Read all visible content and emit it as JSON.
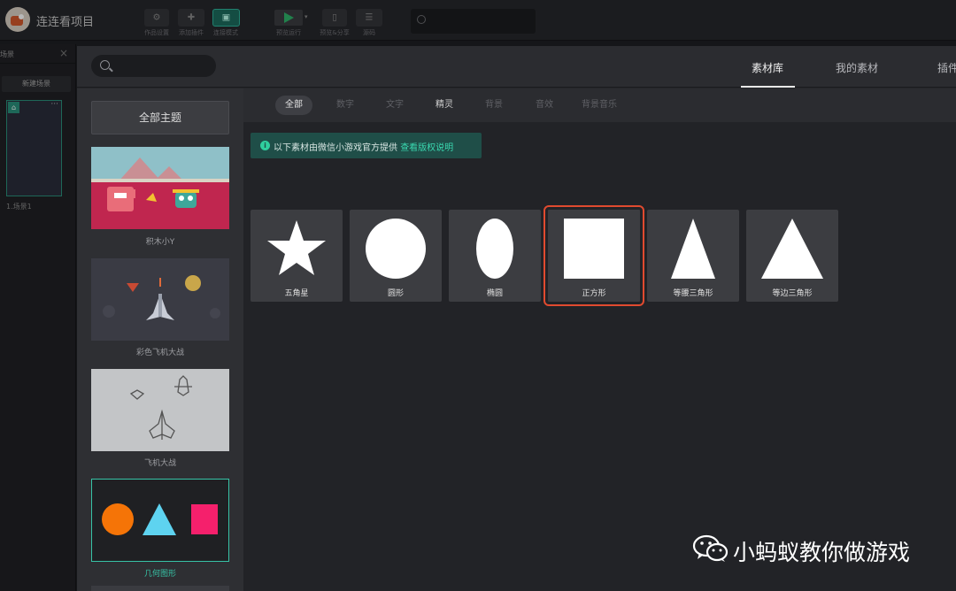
{
  "app": {
    "project_title": "连连看项目",
    "toolbar": [
      {
        "label": "作品设置",
        "icon": "gear-icon"
      },
      {
        "label": "添加插件",
        "icon": "puzzle-icon"
      },
      {
        "label": "连接模式",
        "icon": "device-icon"
      },
      {
        "label": "预览运行",
        "icon": "play-icon"
      },
      {
        "label": "预览&分享",
        "icon": "phone-icon"
      },
      {
        "label": "源码",
        "icon": "list-icon"
      }
    ]
  },
  "scene_panel": {
    "title": "场景",
    "new_scene": "新建场景",
    "scenes": [
      {
        "name": "1.场景1"
      }
    ]
  },
  "modal": {
    "search_placeholder": "",
    "tabs": [
      "素材库",
      "我的素材",
      "插件"
    ],
    "active_tab": "素材库",
    "all_themes": "全部主题",
    "themes": [
      {
        "name": "积木小Y"
      },
      {
        "name": "彩色飞机大战"
      },
      {
        "name": "飞机大战"
      },
      {
        "name": "几何图形",
        "selected": true
      }
    ],
    "filters": [
      "全部",
      "数字",
      "文字",
      "精灵",
      "背景",
      "音效",
      "背景音乐"
    ],
    "active_filter": "全部",
    "notice": {
      "text": "以下素材由微信小游戏官方提供",
      "link": "查看版权说明"
    },
    "assets": [
      {
        "name": "五角星",
        "shape": "star"
      },
      {
        "name": "圆形",
        "shape": "circle"
      },
      {
        "name": "椭圆",
        "shape": "ellipse"
      },
      {
        "name": "正方形",
        "shape": "square",
        "highlighted": true
      },
      {
        "name": "等腰三角形",
        "shape": "isosceles-triangle"
      },
      {
        "name": "等边三角形",
        "shape": "equilateral-triangle"
      }
    ]
  },
  "colors": {
    "accent": "#2fb39a",
    "highlight": "#e04a2f",
    "circle": "#f57407",
    "triangle": "#5ed3f0",
    "square": "#f5206c"
  },
  "watermark": {
    "text": "小蚂蚁教你做游戏",
    "icon": "wechat-icon"
  }
}
